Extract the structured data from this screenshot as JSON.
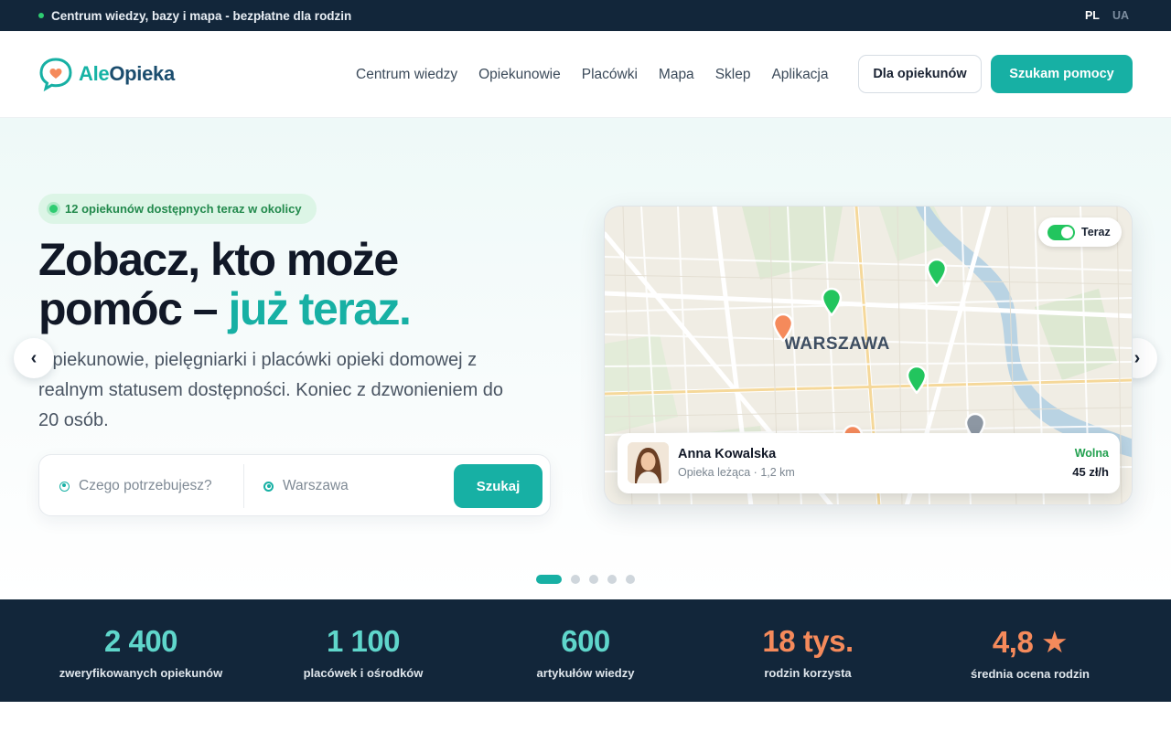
{
  "topbar": {
    "message": "Centrum wiedzy, bazy i mapa - bezpłatne dla rodzin",
    "languages": [
      {
        "code": "PL",
        "active": true
      },
      {
        "code": "UA",
        "active": false
      }
    ]
  },
  "header": {
    "logo": {
      "part1": "Ale",
      "part2": "Opieka"
    },
    "nav": [
      "Centrum wiedzy",
      "Opiekunowie",
      "Placówki",
      "Mapa",
      "Sklep",
      "Aplikacja"
    ],
    "cta_secondary": "Dla opiekunów",
    "cta_primary": "Szukam pomocy"
  },
  "hero": {
    "badge": "12 opiekunów dostępnych teraz w okolicy",
    "headline_line1": "Zobacz, kto może",
    "headline_line2_plain": "pomóc – ",
    "headline_line2_accent": "już teraz.",
    "lead": "Opiekunowie, pielęgniarki i placówki opieki domowej z realnym statusem dostępności. Koniec z dzwonieniem do 20 osób.",
    "search": {
      "what_placeholder": "Czego potrzebujesz?",
      "where_value": "Warszawa",
      "button": "Szukaj"
    },
    "arrow_prev": "‹",
    "arrow_next": "›",
    "slides": {
      "count": 5,
      "active_index": 0
    }
  },
  "map": {
    "toggle_label": "Teraz",
    "toggle_on": true,
    "city": "WARSZAWA",
    "card": {
      "name": "Anna Kowalska",
      "detail": "Opieka leżąca · 1,2 km",
      "status": "Wolna",
      "price": "45 zł/h"
    },
    "colors": {
      "available": "#22c55e",
      "busy": "#f58a5b",
      "offline": "#8d97a3"
    }
  },
  "stats": [
    {
      "value": "2 400",
      "label": "zweryfikowanych opiekunów",
      "color": "teal"
    },
    {
      "value": "1 100",
      "label": "placówek i ośrodków",
      "color": "teal"
    },
    {
      "value": "600",
      "label": "artykułów wiedzy",
      "color": "teal"
    },
    {
      "value": "18 tys.",
      "label": "rodzin korzysta",
      "color": "orange"
    },
    {
      "value": "4,8 ★",
      "label": "średnia ocena rodzin",
      "color": "orange"
    }
  ],
  "theme": {
    "brand": "#17b0a4",
    "navy": "#12263a",
    "accent_orange": "#f58a5b"
  }
}
